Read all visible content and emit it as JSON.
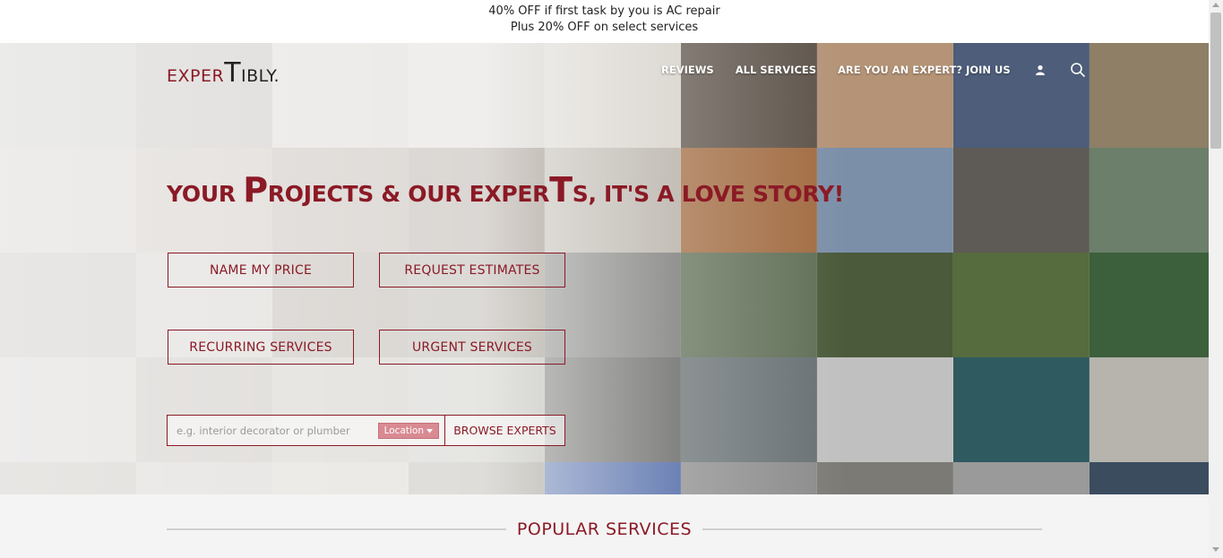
{
  "promo": {
    "line1": "40% OFF if first task by you is AC repair",
    "line2": "Plus 20% OFF on select services"
  },
  "logo": {
    "part1": "EXPER",
    "part2": "T",
    "part3": "IBLY."
  },
  "nav": {
    "reviews": "REVIEWS",
    "all_services": "ALL SERVICES",
    "join": "ARE YOU AN EXPERT? JOIN US",
    "user_icon": "user-icon",
    "search_icon": "search-icon"
  },
  "headline": {
    "p1": "YOUR ",
    "cap1": "P",
    "p2": "ROJECTS & OUR EXPER",
    "cap2": "T",
    "p3": "S, IT'S A LOVE STORY!"
  },
  "cta": {
    "name_price": "NAME MY PRICE",
    "request_estimates": "REQUEST ESTIMATES",
    "recurring": "RECURRING SERVICES",
    "urgent": "URGENT SERVICES"
  },
  "search": {
    "placeholder": "e.g. interior decorator or plumber",
    "location_label": "Location",
    "browse_label": "BROWSE EXPERTS"
  },
  "popular": {
    "title": "POPULAR SERVICES"
  },
  "colors": {
    "accent": "#8b1a26",
    "location_pill": "#d98a92"
  },
  "tiles": [
    "#9a9a94",
    "#8d8880",
    "#b9b4ac",
    "#c6c2bb",
    "#d2cdc5",
    "#5b5148",
    "#b49376",
    "#4d5d7a",
    "#8e7f66",
    "#a9a39a",
    "#9c8f82",
    "#8a7d70",
    "#7d6f62",
    "#b0aaa0",
    "#a06a40",
    "#7b8fa8",
    "#5e5a55",
    "#6b7f6a",
    "#8c8880",
    "#a9a39a",
    "#7a6e60",
    "#80786a",
    "#6f6f6d",
    "#5f6d55",
    "#4a5a3a",
    "#566b3e",
    "#3c5f3c",
    "#a9a4a0",
    "#8d8378",
    "#9e9a8c",
    "#a4a39a",
    "#5a5a58",
    "#676f72",
    "#c0c0c0",
    "#2f5a60",
    "#b6b4ad",
    "#8e8478",
    "#a6a098",
    "#b6aea2",
    "#8a8578",
    "#3d5a9e",
    "#8a8a8a",
    "#7c7a75",
    "#9a9a9a",
    "#3a4c5e"
  ]
}
